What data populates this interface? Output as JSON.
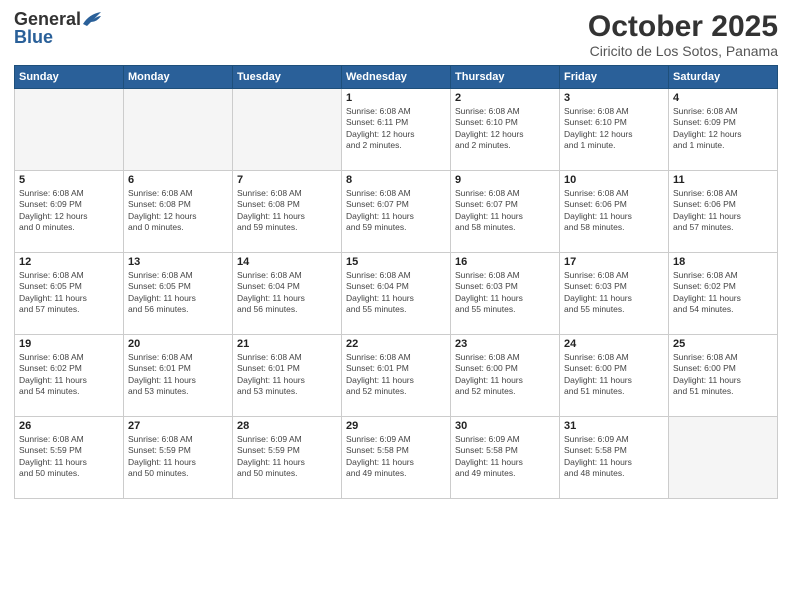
{
  "header": {
    "logo_general": "General",
    "logo_blue": "Blue",
    "month": "October 2025",
    "location": "Ciricito de Los Sotos, Panama"
  },
  "days_of_week": [
    "Sunday",
    "Monday",
    "Tuesday",
    "Wednesday",
    "Thursday",
    "Friday",
    "Saturday"
  ],
  "weeks": [
    [
      {
        "day": "",
        "info": ""
      },
      {
        "day": "",
        "info": ""
      },
      {
        "day": "",
        "info": ""
      },
      {
        "day": "1",
        "info": "Sunrise: 6:08 AM\nSunset: 6:11 PM\nDaylight: 12 hours\nand 2 minutes."
      },
      {
        "day": "2",
        "info": "Sunrise: 6:08 AM\nSunset: 6:10 PM\nDaylight: 12 hours\nand 2 minutes."
      },
      {
        "day": "3",
        "info": "Sunrise: 6:08 AM\nSunset: 6:10 PM\nDaylight: 12 hours\nand 1 minute."
      },
      {
        "day": "4",
        "info": "Sunrise: 6:08 AM\nSunset: 6:09 PM\nDaylight: 12 hours\nand 1 minute."
      }
    ],
    [
      {
        "day": "5",
        "info": "Sunrise: 6:08 AM\nSunset: 6:09 PM\nDaylight: 12 hours\nand 0 minutes."
      },
      {
        "day": "6",
        "info": "Sunrise: 6:08 AM\nSunset: 6:08 PM\nDaylight: 12 hours\nand 0 minutes."
      },
      {
        "day": "7",
        "info": "Sunrise: 6:08 AM\nSunset: 6:08 PM\nDaylight: 11 hours\nand 59 minutes."
      },
      {
        "day": "8",
        "info": "Sunrise: 6:08 AM\nSunset: 6:07 PM\nDaylight: 11 hours\nand 59 minutes."
      },
      {
        "day": "9",
        "info": "Sunrise: 6:08 AM\nSunset: 6:07 PM\nDaylight: 11 hours\nand 58 minutes."
      },
      {
        "day": "10",
        "info": "Sunrise: 6:08 AM\nSunset: 6:06 PM\nDaylight: 11 hours\nand 58 minutes."
      },
      {
        "day": "11",
        "info": "Sunrise: 6:08 AM\nSunset: 6:06 PM\nDaylight: 11 hours\nand 57 minutes."
      }
    ],
    [
      {
        "day": "12",
        "info": "Sunrise: 6:08 AM\nSunset: 6:05 PM\nDaylight: 11 hours\nand 57 minutes."
      },
      {
        "day": "13",
        "info": "Sunrise: 6:08 AM\nSunset: 6:05 PM\nDaylight: 11 hours\nand 56 minutes."
      },
      {
        "day": "14",
        "info": "Sunrise: 6:08 AM\nSunset: 6:04 PM\nDaylight: 11 hours\nand 56 minutes."
      },
      {
        "day": "15",
        "info": "Sunrise: 6:08 AM\nSunset: 6:04 PM\nDaylight: 11 hours\nand 55 minutes."
      },
      {
        "day": "16",
        "info": "Sunrise: 6:08 AM\nSunset: 6:03 PM\nDaylight: 11 hours\nand 55 minutes."
      },
      {
        "day": "17",
        "info": "Sunrise: 6:08 AM\nSunset: 6:03 PM\nDaylight: 11 hours\nand 55 minutes."
      },
      {
        "day": "18",
        "info": "Sunrise: 6:08 AM\nSunset: 6:02 PM\nDaylight: 11 hours\nand 54 minutes."
      }
    ],
    [
      {
        "day": "19",
        "info": "Sunrise: 6:08 AM\nSunset: 6:02 PM\nDaylight: 11 hours\nand 54 minutes."
      },
      {
        "day": "20",
        "info": "Sunrise: 6:08 AM\nSunset: 6:01 PM\nDaylight: 11 hours\nand 53 minutes."
      },
      {
        "day": "21",
        "info": "Sunrise: 6:08 AM\nSunset: 6:01 PM\nDaylight: 11 hours\nand 53 minutes."
      },
      {
        "day": "22",
        "info": "Sunrise: 6:08 AM\nSunset: 6:01 PM\nDaylight: 11 hours\nand 52 minutes."
      },
      {
        "day": "23",
        "info": "Sunrise: 6:08 AM\nSunset: 6:00 PM\nDaylight: 11 hours\nand 52 minutes."
      },
      {
        "day": "24",
        "info": "Sunrise: 6:08 AM\nSunset: 6:00 PM\nDaylight: 11 hours\nand 51 minutes."
      },
      {
        "day": "25",
        "info": "Sunrise: 6:08 AM\nSunset: 6:00 PM\nDaylight: 11 hours\nand 51 minutes."
      }
    ],
    [
      {
        "day": "26",
        "info": "Sunrise: 6:08 AM\nSunset: 5:59 PM\nDaylight: 11 hours\nand 50 minutes."
      },
      {
        "day": "27",
        "info": "Sunrise: 6:08 AM\nSunset: 5:59 PM\nDaylight: 11 hours\nand 50 minutes."
      },
      {
        "day": "28",
        "info": "Sunrise: 6:09 AM\nSunset: 5:59 PM\nDaylight: 11 hours\nand 50 minutes."
      },
      {
        "day": "29",
        "info": "Sunrise: 6:09 AM\nSunset: 5:58 PM\nDaylight: 11 hours\nand 49 minutes."
      },
      {
        "day": "30",
        "info": "Sunrise: 6:09 AM\nSunset: 5:58 PM\nDaylight: 11 hours\nand 49 minutes."
      },
      {
        "day": "31",
        "info": "Sunrise: 6:09 AM\nSunset: 5:58 PM\nDaylight: 11 hours\nand 48 minutes."
      },
      {
        "day": "",
        "info": ""
      }
    ]
  ]
}
